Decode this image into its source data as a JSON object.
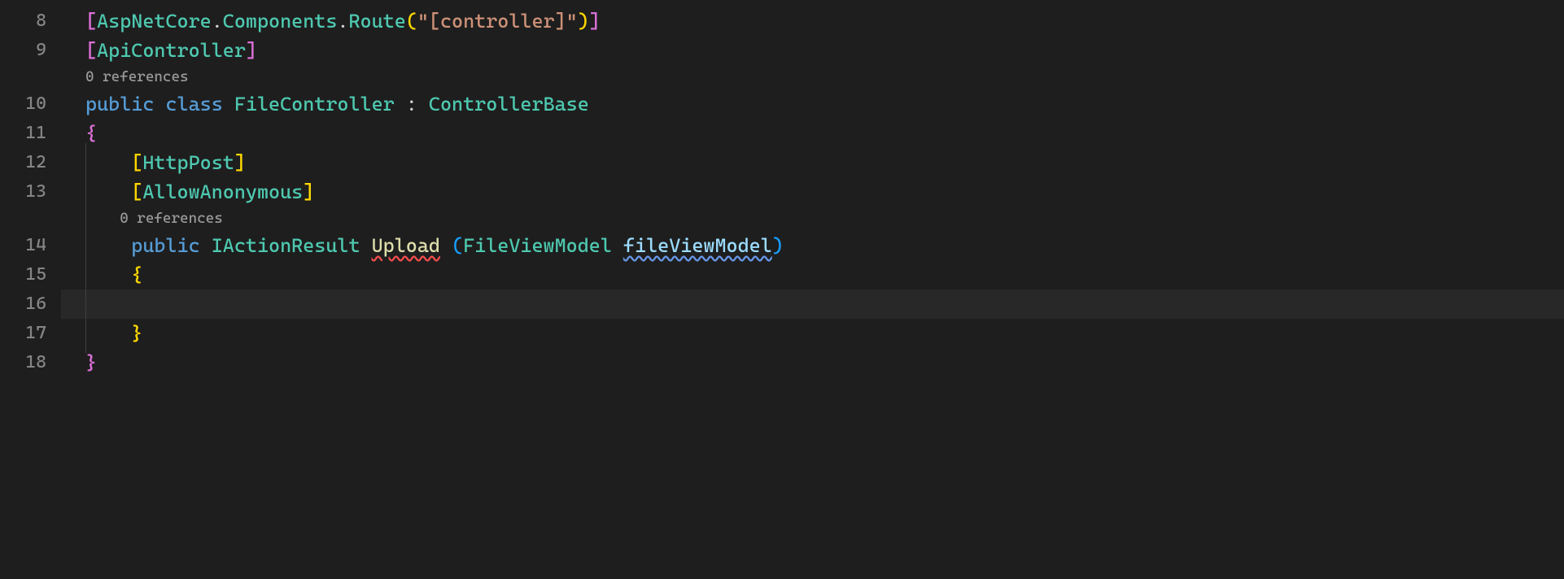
{
  "gutter": {
    "l8": "8",
    "l9": "9",
    "l10": "10",
    "l11": "11",
    "l12": "12",
    "l13": "13",
    "l14": "14",
    "l15": "15",
    "l16": "16",
    "l17": "17",
    "l18": "18"
  },
  "codelens": {
    "class": "0 references",
    "method": "0 references"
  },
  "code": {
    "l8": {
      "open": "[",
      "ns1": "AspNetCore",
      "dot1": ".",
      "ns2": "Components",
      "dot2": ".",
      "attr": "Route",
      "popen": "(",
      "str": "\"[controller]\"",
      "pclose": ")",
      "close": "]"
    },
    "l9": {
      "open": "[",
      "attr": "ApiController",
      "close": "]"
    },
    "l10": {
      "kw1": "public",
      "sp1": " ",
      "kw2": "class",
      "sp2": " ",
      "name": "FileController",
      "sp3": " ",
      "colon": ":",
      "sp4": " ",
      "base": "ControllerBase"
    },
    "l11": {
      "brace": "{"
    },
    "l12": {
      "open": "[",
      "attr": "HttpPost",
      "close": "]"
    },
    "l13": {
      "open": "[",
      "attr": "AllowAnonymous",
      "close": "]"
    },
    "l14": {
      "kw1": "public",
      "sp1": " ",
      "ret": "IActionResult",
      "sp2": " ",
      "method": "Upload",
      "sp3": " ",
      "popen": "(",
      "ptype": "FileViewModel",
      "sp4": " ",
      "pname": "fileViewModel",
      "pclose": ")"
    },
    "l15": {
      "brace": "{"
    },
    "l17": {
      "brace": "}"
    },
    "l18": {
      "brace": "}"
    }
  }
}
